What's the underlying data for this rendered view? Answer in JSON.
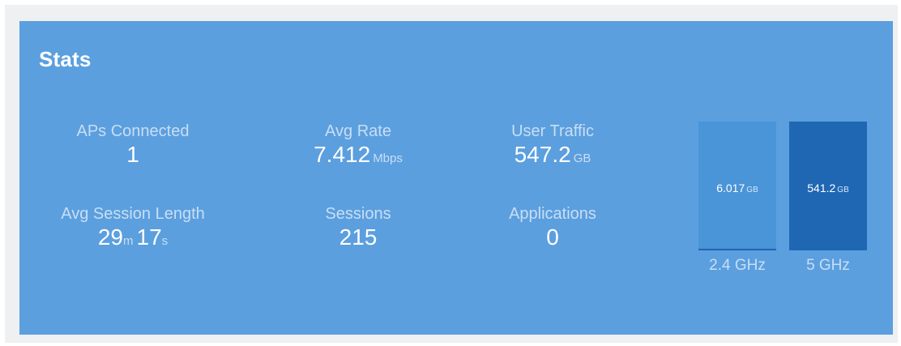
{
  "card": {
    "title": "Stats"
  },
  "stats": {
    "aps_connected": {
      "label": "APs Connected",
      "value": "1"
    },
    "avg_rate": {
      "label": "Avg Rate",
      "value": "7.412",
      "unit": "Mbps"
    },
    "user_traffic": {
      "label": "User Traffic",
      "value": "547.2",
      "unit": "GB"
    },
    "avg_session_length": {
      "label": "Avg Session Length",
      "minutes": "29",
      "minutes_unit": "m",
      "seconds": "17",
      "seconds_unit": "s"
    },
    "sessions": {
      "label": "Sessions",
      "value": "215"
    },
    "applications": {
      "label": "Applications",
      "value": "0"
    }
  },
  "traffic_bars": {
    "band_24": {
      "label": "2.4 GHz",
      "value": "6.017",
      "unit": "GB",
      "fill_fraction": 0.011,
      "bg": "#4a94d8",
      "fill": "#1f67b3"
    },
    "band_5": {
      "label": "5 GHz",
      "value": "541.2",
      "unit": "GB",
      "fill_fraction": 0.989,
      "bg": "#1f67b3",
      "fill": "#1f67b3"
    }
  },
  "colors": {
    "card_bg": "#5b9fdf",
    "frame_bg": "#eef0f2",
    "dark_bar": "#1f67b3"
  }
}
